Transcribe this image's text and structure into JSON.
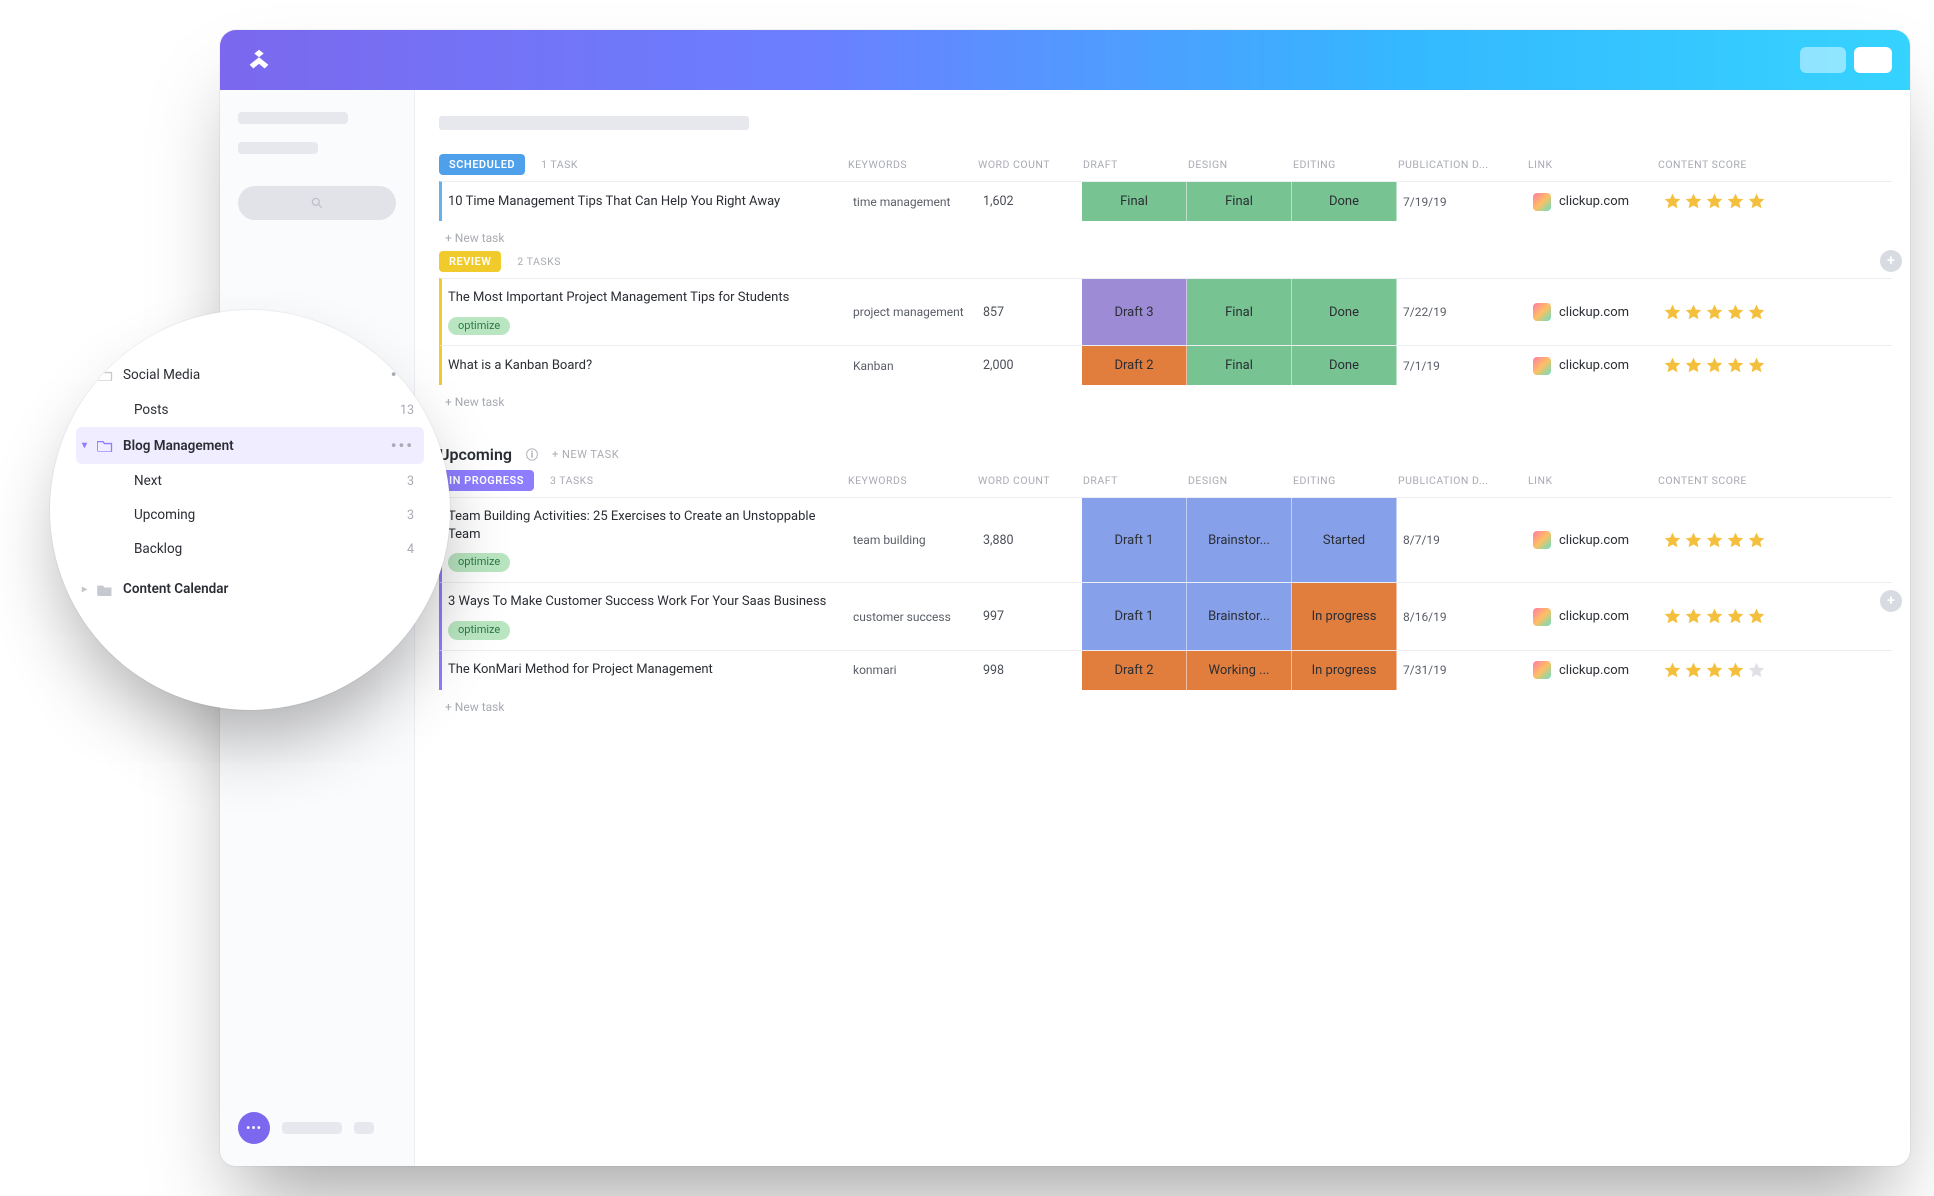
{
  "columns": {
    "name": "",
    "keywords": "KEYWORDS",
    "word_count": "WORD COUNT",
    "draft": "DRAFT",
    "design": "DESIGN",
    "editing": "EDITING",
    "pub_date": "PUBLICATION D...",
    "link": "LINK",
    "score": "CONTENT SCORE"
  },
  "new_task_label": "+ New task",
  "new_task_upper": "+ NEW TASK",
  "link_text": "clickup.com",
  "upcoming_title": "Upcoming",
  "tag_optimize": "optimize",
  "colors": {
    "scheduled_chip": "#4ea0eb",
    "review_chip": "#f1ca2c",
    "inprogress_chip": "#8f7dff",
    "green": "#77c392",
    "orange": "#e17d3d",
    "lavender": "#87a0ea",
    "purple_draft": "#9e8bd5"
  },
  "groups": {
    "scheduled": {
      "status_label": "SCHEDULED",
      "task_count": "1 TASK",
      "rows": [
        {
          "title": "10 Time Management Tips That Can Help You Right Away",
          "keywords": "time management",
          "word_count": "1,602",
          "draft": "Final",
          "design": "Final",
          "editing": "Done",
          "pub_date": "7/19/19",
          "stars": 5
        }
      ]
    },
    "review": {
      "status_label": "REVIEW",
      "task_count": "2 TASKS",
      "rows": [
        {
          "title": "The Most Important Project Management Tips for Students",
          "tag": true,
          "keywords": "project management",
          "word_count": "857",
          "draft": "Draft 3",
          "draft_color": "#9e8bd5",
          "design": "Final",
          "editing": "Done",
          "pub_date": "7/22/19",
          "stars": 5
        },
        {
          "title": "What is a Kanban Board?",
          "keywords": "Kanban",
          "word_count": "2,000",
          "draft": "Draft 2",
          "draft_color": "#e17d3d",
          "design": "Final",
          "editing": "Done",
          "pub_date": "7/1/19",
          "stars": 5
        }
      ]
    },
    "inprogress": {
      "status_label": "IN PROGRESS",
      "task_count": "3 TASKS",
      "rows": [
        {
          "title": "Team Building Activities: 25 Exercises to Create an Unstoppable Team",
          "title_prefix_cut": "am Building Activities: 25 Exercises to Create an nstoppable Team",
          "tag": true,
          "keywords": "team building",
          "word_count": "3,880",
          "draft": "Draft 1",
          "design": "Brainstor...",
          "editing": "Started",
          "pub_date": "8/7/19",
          "stars": 5
        },
        {
          "title": "3 Ways To Make Customer Success Work For Your Saas Business",
          "tag": true,
          "keywords": "customer success",
          "word_count": "997",
          "draft": "Draft 1",
          "design": "Brainstor...",
          "editing": "In progress",
          "editing_color": "#e17d3d",
          "pub_date": "8/16/19",
          "stars": 5
        },
        {
          "title": "The KonMari Method for Project Management",
          "keywords": "konmari",
          "word_count": "998",
          "all_orange": true,
          "draft": "Draft 2",
          "design": "Working ...",
          "editing": "In progress",
          "pub_date": "7/31/19",
          "stars": 4
        }
      ]
    }
  },
  "sidebar": {
    "social_media": {
      "label": "Social Media",
      "posts_label": "Posts",
      "posts_count": "13"
    },
    "blog": {
      "label": "Blog Management",
      "items": [
        {
          "label": "Next",
          "count": "3"
        },
        {
          "label": "Upcoming",
          "count": "3"
        },
        {
          "label": "Backlog",
          "count": "4"
        }
      ]
    },
    "content_calendar": {
      "label": "Content Calendar"
    }
  }
}
